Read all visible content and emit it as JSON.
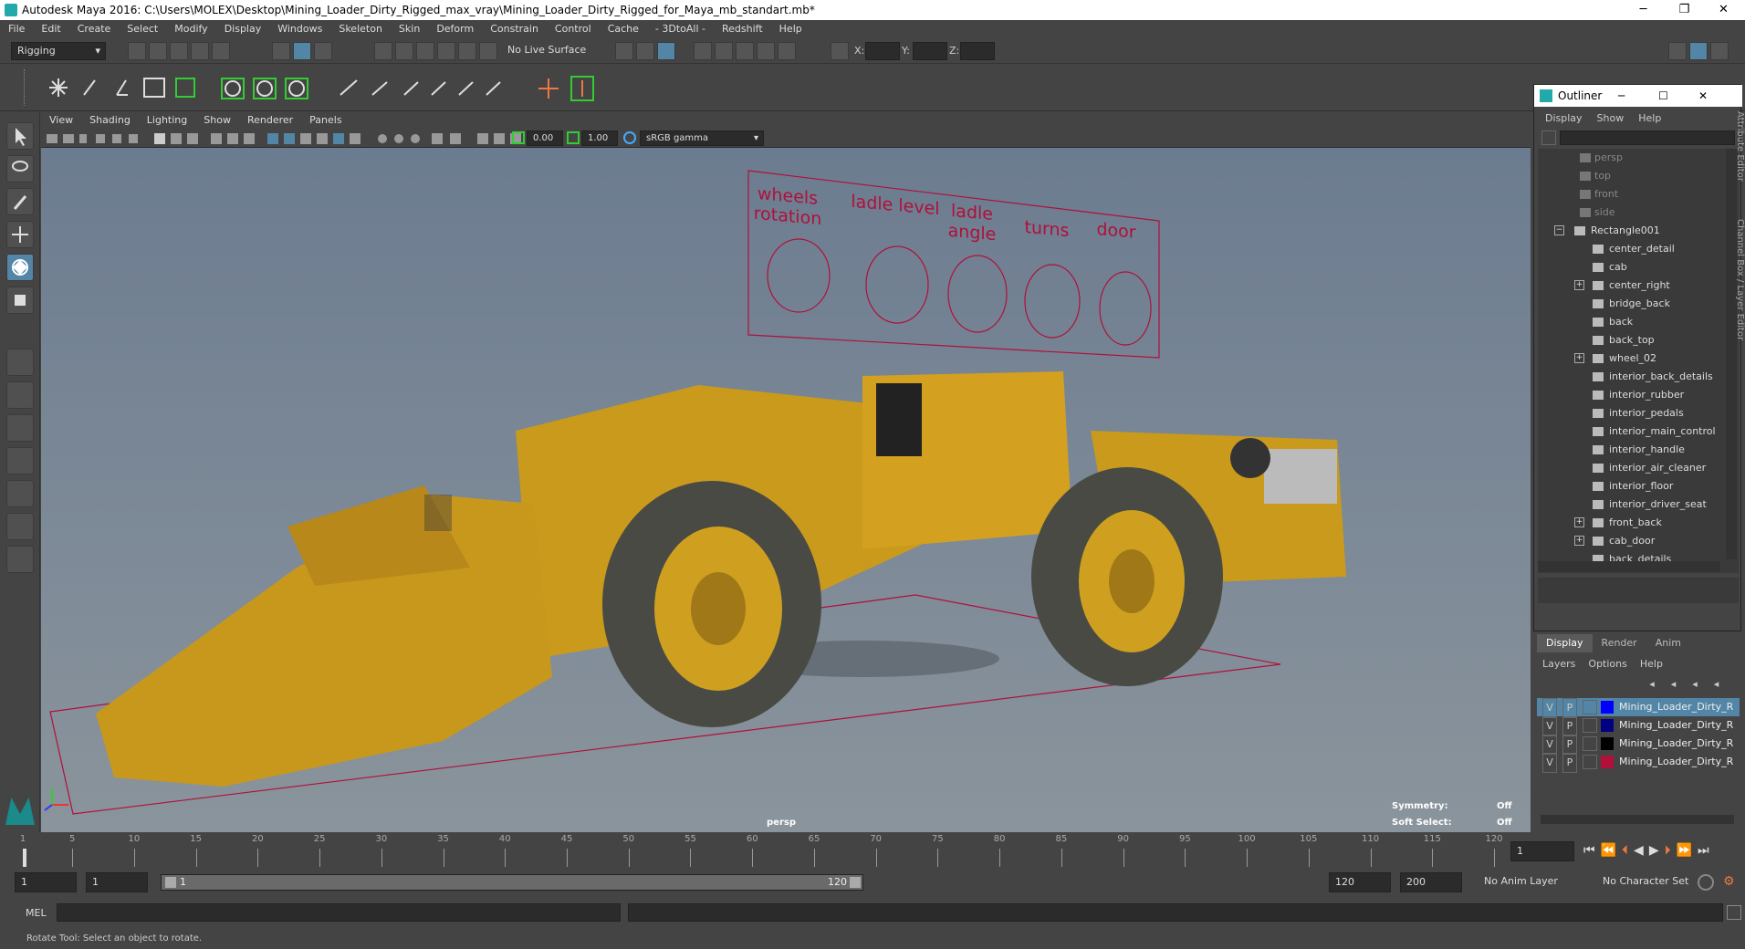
{
  "window": {
    "title": "Autodesk Maya 2016: C:\\Users\\MOLEX\\Desktop\\Mining_Loader_Dirty_Rigged_max_vray\\Mining_Loader_Dirty_Rigged_for_Maya_mb_standart.mb*"
  },
  "menubar": [
    "File",
    "Edit",
    "Create",
    "Select",
    "Modify",
    "Display",
    "Windows",
    "Skeleton",
    "Skin",
    "Deform",
    "Constrain",
    "Control",
    "Cache",
    "- 3DtoAll -",
    "Redshift",
    "Help"
  ],
  "status": {
    "mode": "Rigging",
    "live_surface": "No Live Surface",
    "x_label": "X:",
    "y_label": "Y:",
    "z_label": "Z:"
  },
  "viewport": {
    "menu": [
      "View",
      "Shading",
      "Lighting",
      "Show",
      "Renderer",
      "Panels"
    ],
    "exposure": "0.00",
    "gamma": "1.00",
    "colorspace": "sRGB gamma",
    "camera_label": "persp",
    "symmetry_label": "Symmetry:",
    "symmetry_value": "Off",
    "softselect_label": "Soft Select:",
    "softselect_value": "Off",
    "rig_panel": {
      "labels": [
        "wheels rotation",
        "ladle level",
        "ladle angle",
        "turns",
        "door"
      ]
    }
  },
  "outliner": {
    "title": "Outliner",
    "menu": [
      "Display",
      "Show",
      "Help"
    ],
    "items": [
      {
        "label": "persp",
        "dim": true,
        "indent": 2
      },
      {
        "label": "top",
        "dim": true,
        "indent": 2
      },
      {
        "label": "front",
        "dim": true,
        "indent": 2
      },
      {
        "label": "side",
        "dim": true,
        "indent": 2
      },
      {
        "label": "Rectangle001",
        "dim": false,
        "indent": 1,
        "expand": "-"
      },
      {
        "label": "center_detail",
        "indent": 3
      },
      {
        "label": "cab",
        "indent": 3
      },
      {
        "label": "center_right",
        "indent": 3,
        "expand": "+"
      },
      {
        "label": "bridge_back",
        "indent": 3
      },
      {
        "label": "back",
        "indent": 3
      },
      {
        "label": "back_top",
        "indent": 3
      },
      {
        "label": "wheel_02",
        "indent": 3,
        "expand": "+"
      },
      {
        "label": "interior_back_details",
        "indent": 3
      },
      {
        "label": "interior_rubber",
        "indent": 3
      },
      {
        "label": "interior_pedals",
        "indent": 3
      },
      {
        "label": "interior_main_control",
        "indent": 3
      },
      {
        "label": "interior_handle",
        "indent": 3
      },
      {
        "label": "interior_air_cleaner",
        "indent": 3
      },
      {
        "label": "interior_floor",
        "indent": 3
      },
      {
        "label": "interior_driver_seat",
        "indent": 3
      },
      {
        "label": "front_back",
        "indent": 3,
        "expand": "+"
      },
      {
        "label": "cab_door",
        "indent": 3,
        "expand": "+"
      },
      {
        "label": "back_details",
        "indent": 3
      }
    ]
  },
  "layers_panel": {
    "tabs": [
      "Display",
      "Render",
      "Anim"
    ],
    "menu": [
      "Layers",
      "Options",
      "Help"
    ],
    "rows": [
      {
        "v": "V",
        "p": "P",
        "name": "Mining_Loader_Dirty_R",
        "color": "#0000ff",
        "selected": true
      },
      {
        "v": "V",
        "p": "P",
        "name": "Mining_Loader_Dirty_R",
        "color": "#000080",
        "selected": false
      },
      {
        "v": "V",
        "p": "P",
        "name": "Mining_Loader_Dirty_R",
        "color": "#000000",
        "selected": false
      },
      {
        "v": "V",
        "p": "P",
        "name": "Mining_Loader_Dirty_R",
        "color": "#b0103a",
        "selected": false
      }
    ]
  },
  "timeline": {
    "ticks": [
      "1",
      "5",
      "10",
      "15",
      "20",
      "25",
      "30",
      "35",
      "40",
      "45",
      "50",
      "55",
      "60",
      "65",
      "70",
      "75",
      "80",
      "85",
      "90",
      "95",
      "100",
      "105",
      "110",
      "115",
      "120"
    ],
    "current_frame": "1"
  },
  "range": {
    "start": "1",
    "anim_start": "1",
    "slider_start": "1",
    "slider_end": "120",
    "anim_end": "120",
    "end": "200",
    "anim_layer": "No Anim Layer",
    "char_set": "No Character Set"
  },
  "cmd": {
    "label": "MEL"
  },
  "help_line": "Rotate Tool: Select an object to rotate.",
  "colors": {
    "accent": "#5285a6",
    "rig": "#c0103a",
    "loader": "#d4a020"
  }
}
